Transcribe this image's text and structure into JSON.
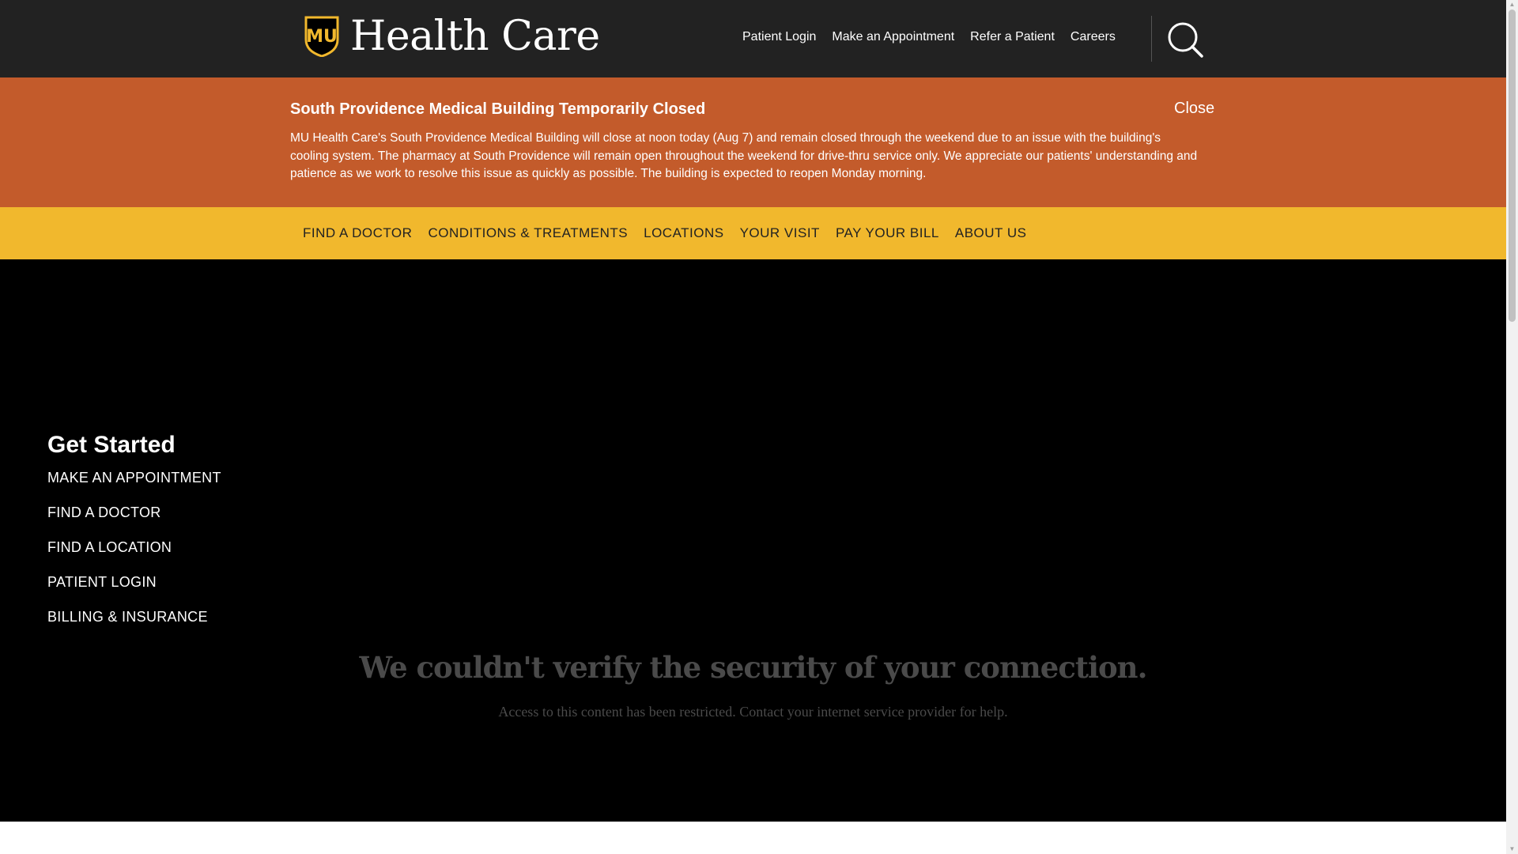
{
  "header": {
    "logo_badge_text": "MU",
    "logo_text": "Health Care",
    "utility_links": [
      "Patient Login",
      "Make an Appointment",
      "Refer a Patient",
      "Careers"
    ],
    "search_icon": "search-icon"
  },
  "alert": {
    "title": "South Providence Medical Building Temporarily Closed",
    "close_label": "Close",
    "body": "MU Health Care's South Providence Medical Building will close at noon today (Aug 7) and remain closed through the weekend due to an issue with the building's cooling system. The pharmacy at South Providence will remain open throughout the weekend for drive-thru service only. We appreciate our patients' understanding and patience as we work to resolve this issue as quickly as possible. The building is expected to reopen Monday morning."
  },
  "main_nav": [
    "FIND A DOCTOR",
    "CONDITIONS & TREATMENTS",
    "LOCATIONS",
    "YOUR VISIT",
    "PAY YOUR BILL",
    "ABOUT US"
  ],
  "get_started": {
    "title": "Get Started",
    "links": [
      "MAKE AN APPOINTMENT",
      "FIND A DOCTOR",
      "FIND A LOCATION",
      "PATIENT LOGIN",
      "BILLING & INSURANCE"
    ]
  },
  "error": {
    "title": "We couldn't verify the security of your connection.",
    "message": "Access to this content has been restricted. Contact your internet service provider for help."
  },
  "colors": {
    "topbar": "#222222",
    "alert": "#c35b2b",
    "nav": "#f1b82d",
    "brand_gold": "#f1b82d"
  }
}
